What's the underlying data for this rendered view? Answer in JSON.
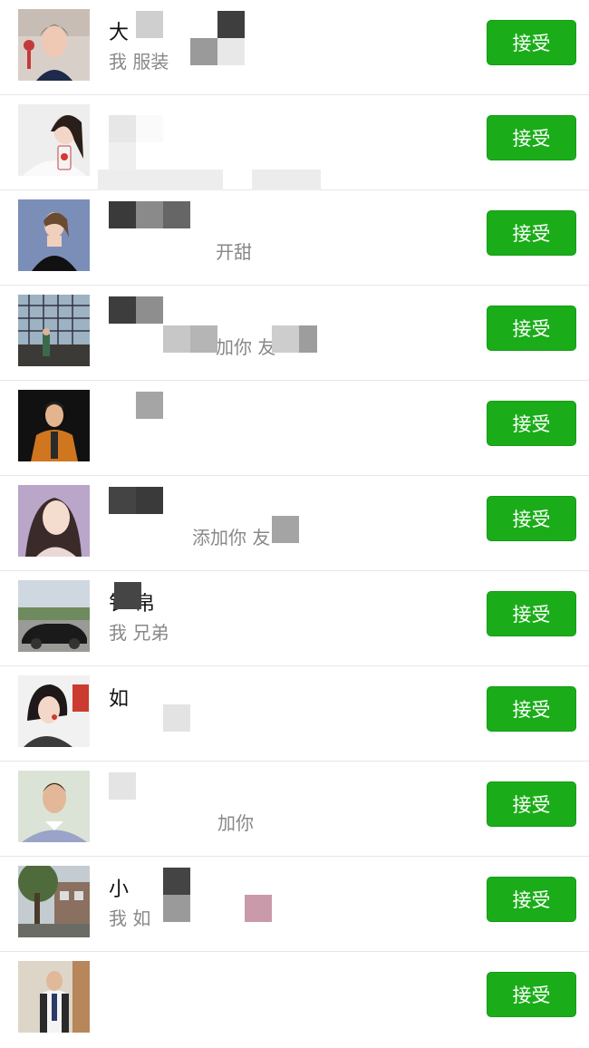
{
  "requests": [
    {
      "name": "大",
      "message": "我 服装",
      "accept_label": "接受",
      "avatar_icon": "avatar-woman-short-hair"
    },
    {
      "name": "",
      "message": "",
      "accept_label": "接受",
      "avatar_icon": "avatar-woman-drink"
    },
    {
      "name": "",
      "message": "开甜",
      "accept_label": "接受",
      "avatar_icon": "avatar-woman-black-dress"
    },
    {
      "name": "",
      "message": "加你 友",
      "accept_label": "接受",
      "avatar_icon": "avatar-woman-window"
    },
    {
      "name": "",
      "message": "",
      "accept_label": "接受",
      "avatar_icon": "avatar-man-orange-suit"
    },
    {
      "name": "",
      "message": "添加你 友",
      "accept_label": "接受",
      "avatar_icon": "avatar-woman-portrait"
    },
    {
      "name": "钅 帛",
      "message": "我 兄弟",
      "accept_label": "接受",
      "avatar_icon": "avatar-black-car"
    },
    {
      "name": "如",
      "message": "",
      "accept_label": "接受",
      "avatar_icon": "avatar-woman-eating"
    },
    {
      "name": "",
      "message": "加你",
      "accept_label": "接受",
      "avatar_icon": "avatar-man-collar"
    },
    {
      "name": "小",
      "message": "我 如",
      "accept_label": "接受",
      "avatar_icon": "avatar-street-tree"
    },
    {
      "name": "",
      "message": "",
      "accept_label": "接受",
      "avatar_icon": "avatar-man-suit-full"
    }
  ],
  "colors": {
    "accept_button": "#1AAD19",
    "divider": "#e6e6e6"
  }
}
